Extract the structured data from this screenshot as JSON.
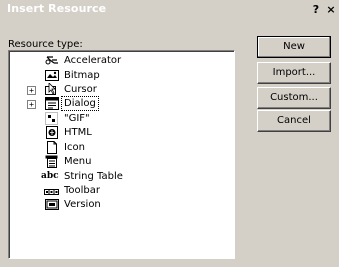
{
  "window": {
    "title": "Insert Resource",
    "help_button": "?",
    "close_button": "×"
  },
  "resource_list": {
    "label": "Resource type:",
    "items": [
      {
        "label": "Accelerator",
        "icon": "accelerator-icon",
        "expandable": false
      },
      {
        "label": "Bitmap",
        "icon": "bitmap-icon",
        "expandable": false
      },
      {
        "label": "Cursor",
        "icon": "cursor-icon",
        "expandable": true,
        "expander": "+"
      },
      {
        "label": "Dialog",
        "icon": "dialog-icon",
        "expandable": true,
        "expander": "+",
        "focused": true
      },
      {
        "label": "\"GIF\"",
        "icon": "gif-icon",
        "expandable": false
      },
      {
        "label": "HTML",
        "icon": "html-icon",
        "expandable": false
      },
      {
        "label": "Icon",
        "icon": "icon-resource-icon",
        "expandable": false
      },
      {
        "label": "Menu",
        "icon": "menu-icon",
        "expandable": false
      },
      {
        "label": "String Table",
        "icon": "string-table-icon",
        "expandable": false,
        "icon_text": "abc"
      },
      {
        "label": "Toolbar",
        "icon": "toolbar-icon",
        "expandable": false
      },
      {
        "label": "Version",
        "icon": "version-icon",
        "expandable": false
      }
    ]
  },
  "buttons": {
    "new": "New",
    "import": "Import...",
    "custom": "Custom...",
    "cancel": "Cancel"
  }
}
